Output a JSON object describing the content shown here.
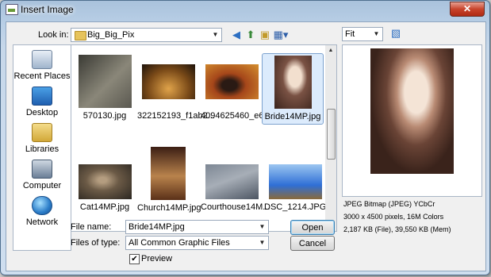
{
  "window": {
    "title": "Insert Image",
    "close_label": "✕"
  },
  "toolbar": {
    "look_in_label": "Look in:",
    "look_in_value": "Big_Big_Pix",
    "icons": [
      "back-icon",
      "up-folder-icon",
      "new-folder-icon",
      "views-icon"
    ]
  },
  "places": [
    {
      "label": "Recent Places",
      "icon": "recent-places-icon"
    },
    {
      "label": "Desktop",
      "icon": "desktop-icon"
    },
    {
      "label": "Libraries",
      "icon": "libraries-icon"
    },
    {
      "label": "Computer",
      "icon": "computer-icon"
    },
    {
      "label": "Network",
      "icon": "network-icon"
    }
  ],
  "files": [
    {
      "name": "570130.jpg",
      "selected": false,
      "colors": [
        "#3a3a34",
        "#8a8779"
      ]
    },
    {
      "name": "322152193_f1ab2...",
      "selected": false,
      "colors": [
        "#1d120a",
        "#c08a3a"
      ]
    },
    {
      "name": "4094625460_e616...",
      "selected": false,
      "colors": [
        "#6a2a12",
        "#d5902f"
      ]
    },
    {
      "name": "Bride14MP.jpg",
      "selected": true,
      "colors": [
        "#4a3026",
        "#e5d2c2"
      ]
    },
    {
      "name": "Cat14MP.jpg",
      "selected": false,
      "colors": [
        "#2b2620",
        "#8c7a62"
      ]
    },
    {
      "name": "Church14MP.jpg",
      "selected": false,
      "colors": [
        "#3b1e14",
        "#b9834c"
      ]
    },
    {
      "name": "Courthouse14M...",
      "selected": false,
      "colors": [
        "#4d5663",
        "#a7aeb7"
      ]
    },
    {
      "name": "DSC_1214.JPG",
      "selected": false,
      "colors": [
        "#2f6fd6",
        "#9cc6f1"
      ]
    }
  ],
  "file_name": {
    "label": "File name:",
    "value": "Bride14MP.jpg"
  },
  "file_type": {
    "label": "Files of type:",
    "value": "All Common Graphic Files"
  },
  "buttons": {
    "open": "Open",
    "cancel": "Cancel"
  },
  "preview": {
    "checkbox_label": "Preview",
    "checked": true,
    "zoom": "Fit",
    "info_line1": "JPEG Bitmap (JPEG) YCbCr",
    "info_line2": "3000 x 4500 pixels, 16M Colors",
    "info_line3": "2,187 KB (File), 39,550 KB (Mem)"
  }
}
